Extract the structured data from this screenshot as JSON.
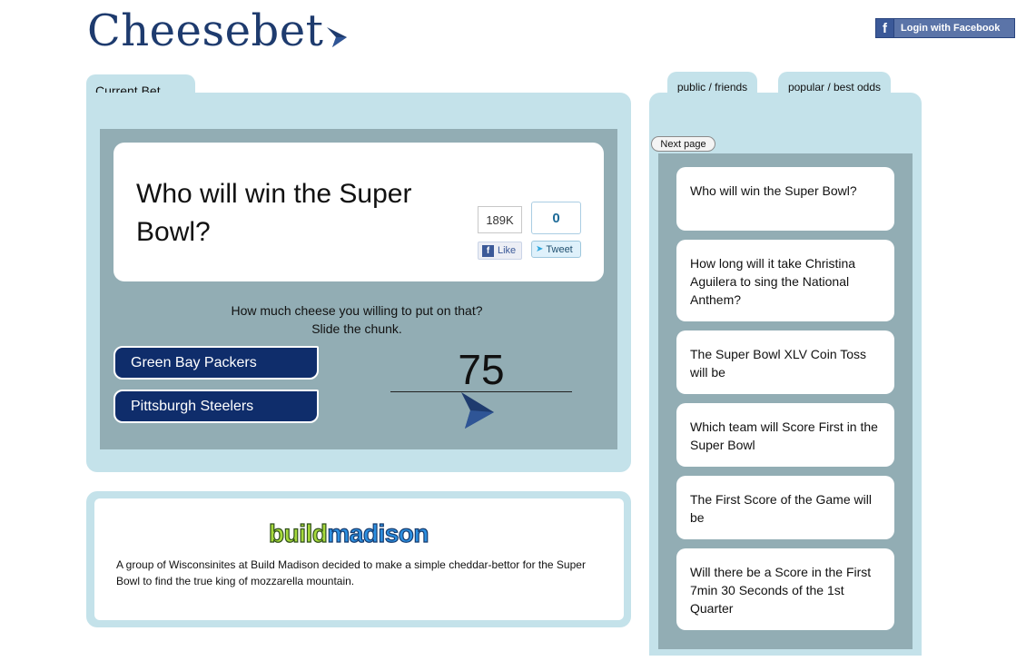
{
  "header": {
    "logo_text": "Cheesebet",
    "login_label": "Login with Facebook"
  },
  "current_bet": {
    "tab_label": "Current Bet",
    "question": "Who will win the Super Bowl?",
    "like_count": "189K",
    "like_label": "Like",
    "tweet_count": "0",
    "tweet_label": "Tweet",
    "prompt_line1": "How much cheese you willing to put on that?",
    "prompt_line2": "Slide the chunk.",
    "options": [
      "Green Bay Packers",
      "Pittsburgh Steelers"
    ],
    "amount": "75"
  },
  "about": {
    "logo_part1": "build",
    "logo_part2": "madison",
    "text": "A group of Wisconsinites at Build Madison decided to make a simple cheddar-bettor for the Super Bowl to find the true king of mozzarella mountain."
  },
  "sidebar": {
    "tabs": [
      "public / friends",
      "popular / best odds"
    ],
    "next_page_label": "Next page",
    "bets": [
      "Who will win the Super Bowl?",
      "How long will it take Christina Aguilera to sing the National Anthem?",
      "The Super Bowl XLV Coin Toss will be",
      "Which team will Score First in the Super Bowl",
      "The First Score of the Game will be",
      "Will there be a Score in the First 7min 30 Seconds of the 1st Quarter"
    ]
  },
  "colors": {
    "brand_navy": "#0f2d6b",
    "panel_light_blue": "#c4e2ea",
    "panel_grey_blue": "#92adb4",
    "logo_blue": "#1e3b6e"
  },
  "icons": [
    "sail-icon",
    "facebook-icon",
    "twitter-bird-icon",
    "cheese-chunk-icon"
  ]
}
